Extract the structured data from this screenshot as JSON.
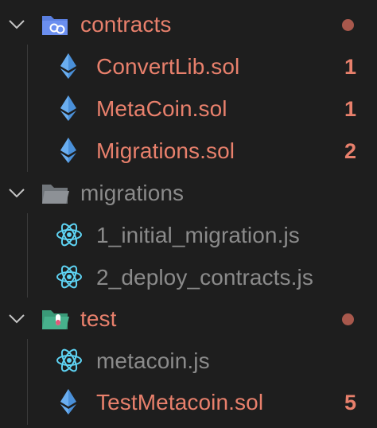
{
  "colors": {
    "error_text": "#e8806c",
    "dim_text": "#8b8b8b",
    "dot": "#a8584c",
    "eth_blue": "#4a90d9",
    "react_cyan": "#5ed3f3",
    "folder_contracts": "#5a7fe0",
    "folder_migrations": "#8d9196",
    "folder_test": "#47b18c"
  },
  "tree": {
    "contracts": {
      "label": "contracts",
      "icon": "folder-contracts-icon",
      "has_problem_dot": true,
      "files": [
        {
          "label": "ConvertLib.sol",
          "icon": "ethereum-icon",
          "badge": "1"
        },
        {
          "label": "MetaCoin.sol",
          "icon": "ethereum-icon",
          "badge": "1"
        },
        {
          "label": "Migrations.sol",
          "icon": "ethereum-icon",
          "badge": "2"
        }
      ]
    },
    "migrations": {
      "label": "migrations",
      "icon": "folder-icon",
      "files": [
        {
          "label": "1_initial_migration.js",
          "icon": "react-icon"
        },
        {
          "label": "2_deploy_contracts.js",
          "icon": "react-icon"
        }
      ]
    },
    "test": {
      "label": "test",
      "icon": "folder-test-icon",
      "has_problem_dot": true,
      "files": [
        {
          "label": "metacoin.js",
          "icon": "react-icon"
        },
        {
          "label": "TestMetacoin.sol",
          "icon": "ethereum-icon",
          "badge": "5"
        }
      ]
    }
  }
}
